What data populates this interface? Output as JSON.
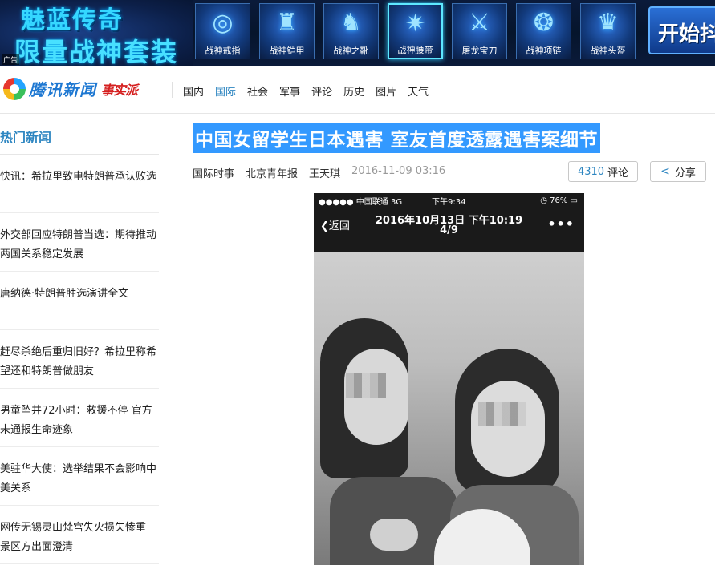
{
  "ad": {
    "title_line1": "魅蓝传奇",
    "title_line2": "限量战神套装",
    "tag": "广告",
    "items": [
      {
        "label": "战神戒指",
        "icon": "ring-icon"
      },
      {
        "label": "战神铠甲",
        "icon": "armor-icon"
      },
      {
        "label": "战神之靴",
        "icon": "boots-icon"
      },
      {
        "label": "战神腰带",
        "icon": "belt-icon"
      },
      {
        "label": "屠龙宝刀",
        "icon": "sword-icon"
      },
      {
        "label": "战神项链",
        "icon": "necklace-icon"
      },
      {
        "label": "战神头盔",
        "icon": "helmet-icon"
      }
    ],
    "selected_index": 3,
    "start_label": "开始抖"
  },
  "nav": {
    "logo_text": "腾讯新闻",
    "logo_sub": "事实派",
    "links": [
      "国内",
      "国际",
      "社会",
      "军事",
      "评论",
      "历史",
      "图片",
      "天气"
    ],
    "active": "国际"
  },
  "sidebar": {
    "title": "热门新闻",
    "items": [
      "快讯：希拉里致电特朗普承认败选",
      "外交部回应特朗普当选：期待推动两国关系稳定发展",
      "唐纳德·特朗普胜选演讲全文",
      "赶尽杀绝后重归旧好？希拉里称希望还和特朗普做朋友",
      "男童坠井72小时：救援不停 官方未通报生命迹象",
      "美驻华大使：选举结果不会影响中美关系",
      "网传无锡灵山梵宫失火损失惨重 景区方出面澄清"
    ]
  },
  "article": {
    "headline": "中国女留学生日本遇害 室友首度透露遇害案细节",
    "category": "国际时事",
    "source": "北京青年报",
    "author": "王天琪",
    "time": "2016-11-09 03:16",
    "comment_count": "4310",
    "comment_label": "评论",
    "share_label": "分享"
  },
  "photo": {
    "carrier": "●●●●● 中国联通  3G",
    "status_time": "下午9:34",
    "battery": "◷ 76% ▭",
    "back_label": "返回",
    "date": "2016年10月13日 下午10:19",
    "page": "4/9"
  },
  "colors": {
    "accent": "#2e86c1",
    "headline_highlight": "#3399ff",
    "brand_red": "#d51f1f"
  }
}
